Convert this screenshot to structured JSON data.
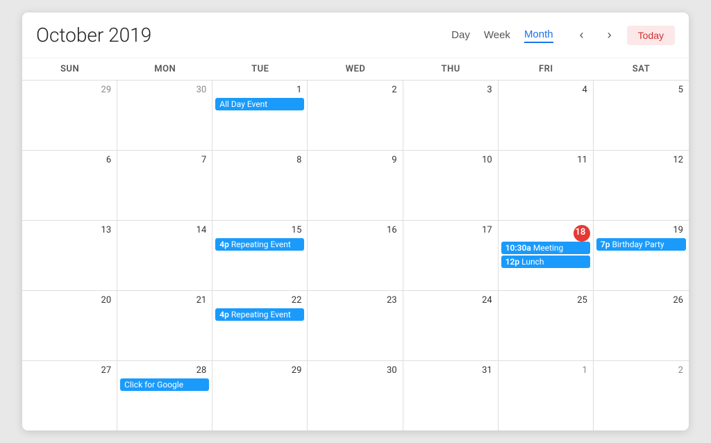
{
  "header": {
    "title": "October 2019",
    "view_day": "Day",
    "view_week": "Week",
    "view_month": "Month",
    "nav_prev": "‹",
    "nav_next": "›",
    "today_label": "Today"
  },
  "day_headers": [
    "Sun",
    "Mon",
    "Tue",
    "Wed",
    "Thu",
    "Fri",
    "Sat"
  ],
  "weeks": [
    {
      "days": [
        {
          "num": "29",
          "type": "other"
        },
        {
          "num": "30",
          "type": "other"
        },
        {
          "num": "1",
          "type": "current",
          "events": [
            {
              "label": "All Day Event",
              "time": ""
            }
          ]
        },
        {
          "num": "2",
          "type": "current"
        },
        {
          "num": "3",
          "type": "current"
        },
        {
          "num": "4",
          "type": "current"
        },
        {
          "num": "5",
          "type": "current"
        }
      ]
    },
    {
      "days": [
        {
          "num": "6",
          "type": "current"
        },
        {
          "num": "7",
          "type": "current"
        },
        {
          "num": "8",
          "type": "current"
        },
        {
          "num": "9",
          "type": "current"
        },
        {
          "num": "10",
          "type": "current"
        },
        {
          "num": "11",
          "type": "current"
        },
        {
          "num": "12",
          "type": "current"
        }
      ]
    },
    {
      "days": [
        {
          "num": "13",
          "type": "current"
        },
        {
          "num": "14",
          "type": "current"
        },
        {
          "num": "15",
          "type": "current",
          "events": [
            {
              "label": "Repeating Event",
              "time": "4p"
            }
          ]
        },
        {
          "num": "16",
          "type": "current"
        },
        {
          "num": "17",
          "type": "current"
        },
        {
          "num": "18",
          "type": "today",
          "events": [
            {
              "label": "Meeting",
              "time": "10:30a"
            },
            {
              "label": "Lunch",
              "time": "12p"
            }
          ]
        },
        {
          "num": "19",
          "type": "current",
          "events": [
            {
              "label": "Birthday Party",
              "time": "7p"
            }
          ]
        }
      ]
    },
    {
      "days": [
        {
          "num": "20",
          "type": "current"
        },
        {
          "num": "21",
          "type": "current"
        },
        {
          "num": "22",
          "type": "current",
          "events": [
            {
              "label": "Repeating Event",
              "time": "4p"
            }
          ]
        },
        {
          "num": "23",
          "type": "current"
        },
        {
          "num": "24",
          "type": "current"
        },
        {
          "num": "25",
          "type": "current"
        },
        {
          "num": "26",
          "type": "current"
        }
      ]
    },
    {
      "days": [
        {
          "num": "27",
          "type": "current"
        },
        {
          "num": "28",
          "type": "current",
          "events": [
            {
              "label": "Click for Google",
              "time": ""
            }
          ]
        },
        {
          "num": "29",
          "type": "current"
        },
        {
          "num": "30",
          "type": "current"
        },
        {
          "num": "31",
          "type": "current"
        },
        {
          "num": "1",
          "type": "other"
        },
        {
          "num": "2",
          "type": "other"
        }
      ]
    }
  ]
}
